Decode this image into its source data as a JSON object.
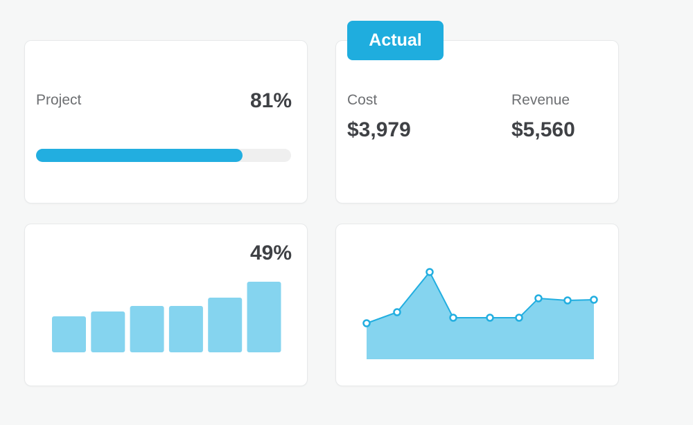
{
  "project_card": {
    "label": "Project",
    "percent_text": "81%",
    "progress": 0.81,
    "accent_color": "#22aee0",
    "track_color": "#efefef"
  },
  "actual_card": {
    "badge": "Actual",
    "badge_color": "#1fadde",
    "cost_label": "Cost",
    "cost_value": "$3,979",
    "revenue_label": "Revenue",
    "revenue_value": "$5,560"
  },
  "bars_card": {
    "percent_text": "49%"
  },
  "chart_data": [
    {
      "type": "bar",
      "values": [
        52,
        59,
        67,
        67,
        79,
        102
      ],
      "ylim": [
        0,
        110
      ],
      "bar_color": "#85d4ef",
      "grid": false
    },
    {
      "type": "area",
      "x": [
        0,
        1,
        2,
        3,
        4,
        5,
        6,
        7,
        8
      ],
      "values": [
        52,
        68,
        126,
        60,
        60,
        60,
        88,
        85,
        86
      ],
      "ylim": [
        0,
        140
      ],
      "fill_color": "#85d4ef",
      "line_color": "#22aee0",
      "grid": false
    }
  ]
}
